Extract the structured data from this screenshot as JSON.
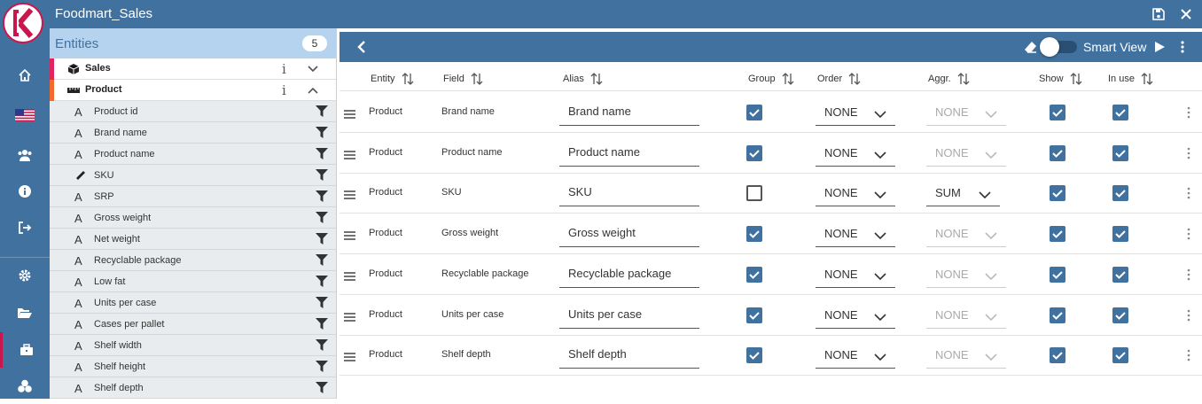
{
  "app": {
    "title": "Foodmart_Sales"
  },
  "nav": [
    {
      "icon": "home-icon"
    },
    {
      "icon": "us-flag-icon"
    },
    {
      "icon": "users-icon"
    },
    {
      "icon": "info-icon"
    },
    {
      "icon": "logout-icon"
    },
    {
      "icon": "settings-icon"
    },
    {
      "icon": "folder-open-icon"
    },
    {
      "icon": "briefcase-icon"
    },
    {
      "icon": "cubes-icon"
    }
  ],
  "entities": {
    "title": "Entities",
    "count": "5",
    "items": [
      {
        "name": "Sales",
        "bar_color": "#e0245e",
        "expanded": false
      },
      {
        "name": "Product",
        "bar_color": "#f26a2e",
        "expanded": true
      }
    ],
    "fields": [
      {
        "type": "A",
        "name": "Product id"
      },
      {
        "type": "A",
        "name": "Brand name"
      },
      {
        "type": "A",
        "name": "Product name"
      },
      {
        "type": "ruler",
        "name": "SKU"
      },
      {
        "type": "A",
        "name": "SRP"
      },
      {
        "type": "A",
        "name": "Gross weight"
      },
      {
        "type": "A",
        "name": "Net weight"
      },
      {
        "type": "A",
        "name": "Recyclable package"
      },
      {
        "type": "A",
        "name": "Low fat"
      },
      {
        "type": "A",
        "name": "Units per case"
      },
      {
        "type": "A",
        "name": "Cases per pallet"
      },
      {
        "type": "A",
        "name": "Shelf width"
      },
      {
        "type": "A",
        "name": "Shelf height"
      },
      {
        "type": "A",
        "name": "Shelf depth"
      }
    ]
  },
  "toolbar": {
    "smart_view_label": "Smart View"
  },
  "table": {
    "headers": {
      "entity": "Entity",
      "field": "Field",
      "alias": "Alias",
      "group": "Group",
      "order": "Order",
      "aggr": "Aggr.",
      "show": "Show",
      "in_use": "In use"
    },
    "rows": [
      {
        "entity": "Product",
        "field": "Brand name",
        "alias": "Brand name",
        "group": true,
        "order": "NONE",
        "aggr": "NONE",
        "aggr_enabled": false,
        "show": true,
        "in_use": true
      },
      {
        "entity": "Product",
        "field": "Product name",
        "alias": "Product name",
        "group": true,
        "order": "NONE",
        "aggr": "NONE",
        "aggr_enabled": false,
        "show": true,
        "in_use": true
      },
      {
        "entity": "Product",
        "field": "SKU",
        "alias": "SKU",
        "group": false,
        "order": "NONE",
        "aggr": "SUM",
        "aggr_enabled": true,
        "show": true,
        "in_use": true
      },
      {
        "entity": "Product",
        "field": "Gross weight",
        "alias": "Gross weight",
        "group": true,
        "order": "NONE",
        "aggr": "NONE",
        "aggr_enabled": false,
        "show": true,
        "in_use": true
      },
      {
        "entity": "Product",
        "field": "Recyclable package",
        "alias": "Recyclable package",
        "group": true,
        "order": "NONE",
        "aggr": "NONE",
        "aggr_enabled": false,
        "show": true,
        "in_use": true
      },
      {
        "entity": "Product",
        "field": "Units per case",
        "alias": "Units per case",
        "group": true,
        "order": "NONE",
        "aggr": "NONE",
        "aggr_enabled": false,
        "show": true,
        "in_use": true
      },
      {
        "entity": "Product",
        "field": "Shelf depth",
        "alias": "Shelf depth",
        "group": true,
        "order": "NONE",
        "aggr": "NONE",
        "aggr_enabled": false,
        "show": true,
        "in_use": true
      }
    ]
  }
}
